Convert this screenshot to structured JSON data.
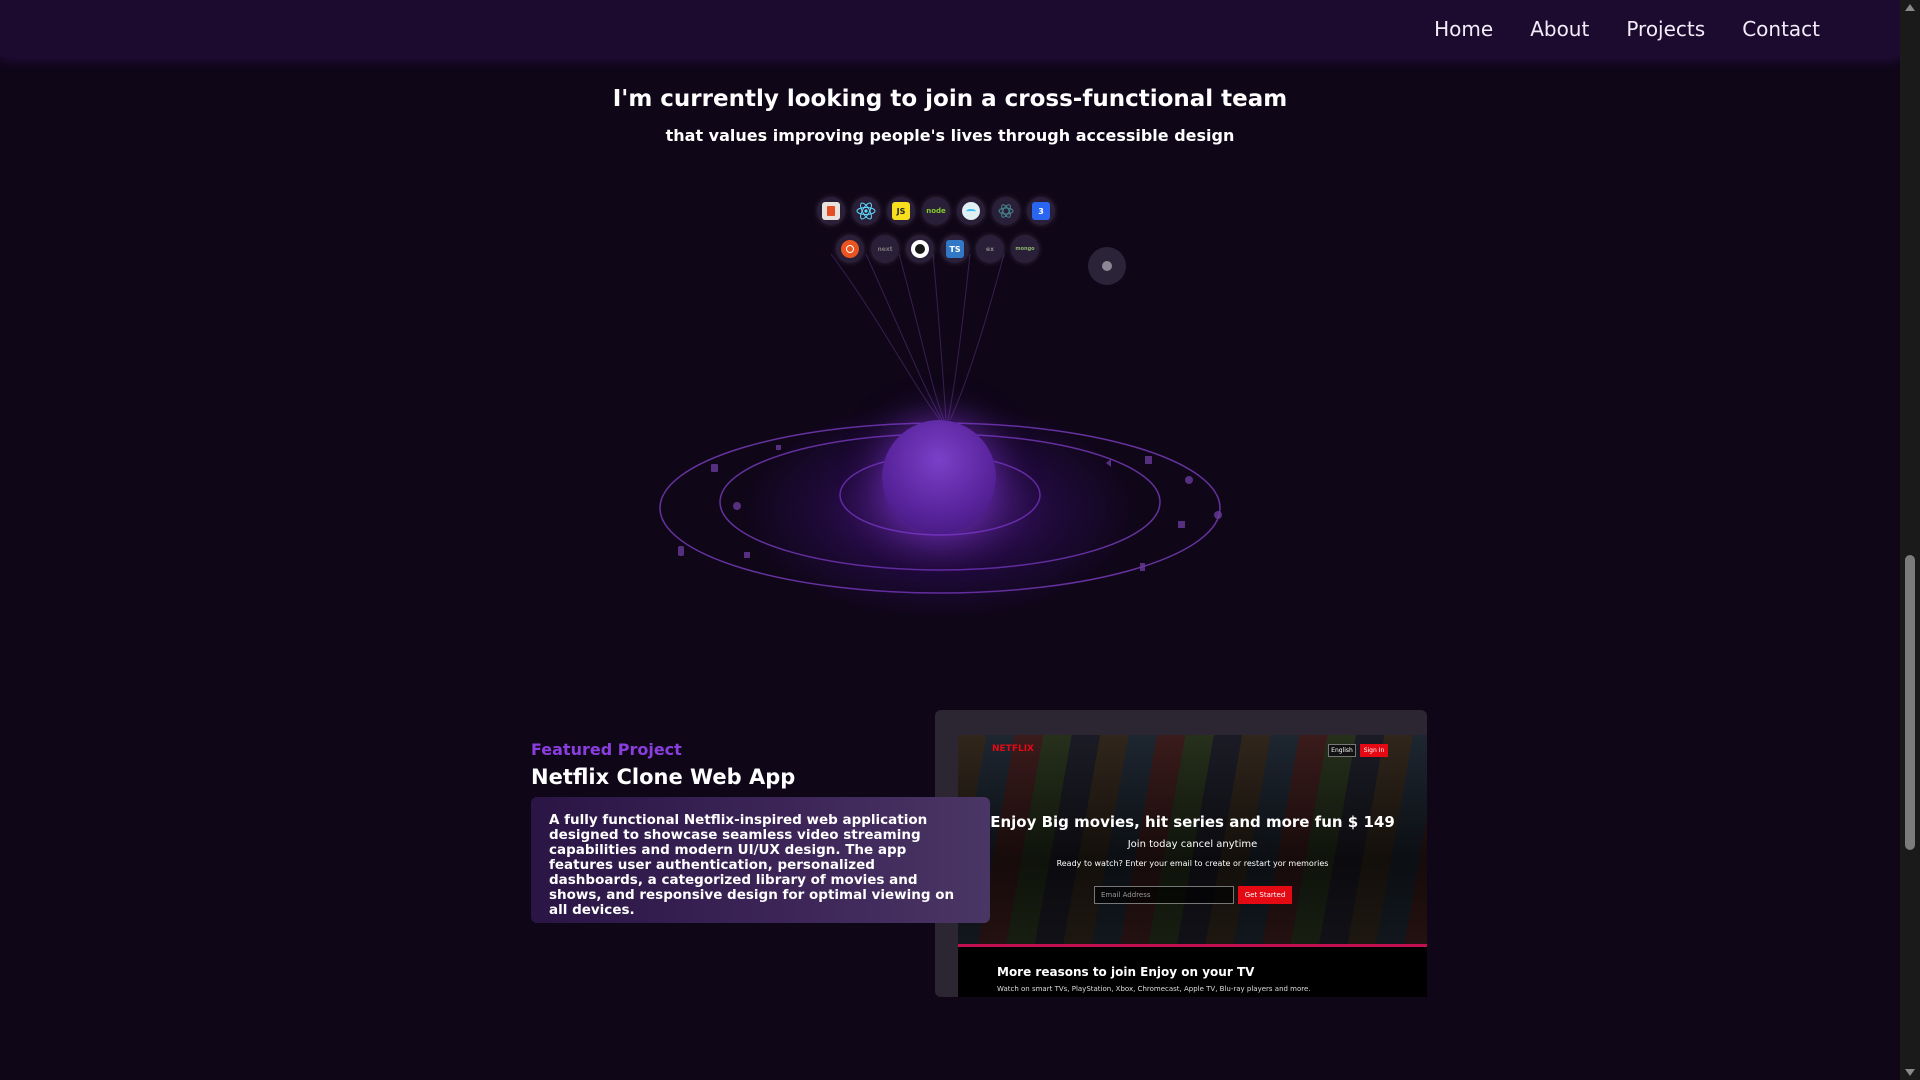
{
  "nav": {
    "links": [
      "Home",
      "About",
      "Projects",
      "Contact"
    ]
  },
  "hero": {
    "headline": "I'm currently looking to join a cross-functional team",
    "subheadline": "that values improving people's lives through accessible design"
  },
  "skills": {
    "row1": [
      "html-icon",
      "react-icon",
      "javascript-icon",
      "nodejs-icon",
      "tailwind-icon",
      "electron-icon",
      "css-icon"
    ],
    "row1_labels": [
      "",
      "",
      "JS",
      "node",
      "",
      "",
      "3"
    ],
    "row2": [
      "ubuntu-icon",
      "next-icon",
      "github-icon",
      "typescript-icon",
      "express-icon",
      "mongodb-icon"
    ],
    "row2_labels": [
      "",
      "next",
      "",
      "TS",
      "ex",
      "mongo"
    ]
  },
  "featured": {
    "label": "Featured Project",
    "title": "Netflix Clone Web App",
    "description": "A fully functional Netflix-inspired web application designed to showcase seamless video streaming capabilities and modern UI/UX design. The app features user authentication, personalized dashboards, a categorized library of movies and shows, and responsive design for optimal viewing on all devices."
  },
  "screenshot": {
    "logo": "NETFLIX",
    "language": "English",
    "signin": "Sign In",
    "hero_title": "Enjoy Big movies, hit series and more fun $ 149",
    "hero_sub": "Join today cancel anytime",
    "hero_sub2": "Ready to watch? Enter your email to create or restart yor memories",
    "email_placeholder": "Email Address",
    "cta": "Get Started",
    "more_title": "More reasons to join Enjoy on your TV",
    "more_sub": "Watch on smart TVs, PlayStation, Xbox, Chromecast, Apple TV, Blu-ray players and more."
  }
}
